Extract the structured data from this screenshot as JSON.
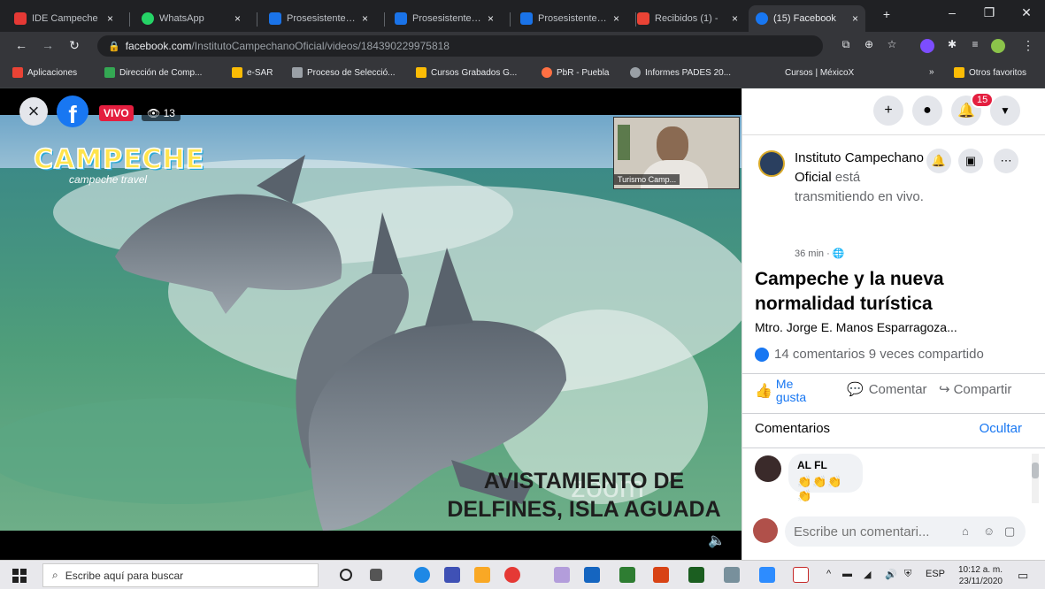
{
  "browser": {
    "tabs": [
      {
        "label": "IDE Campeche",
        "color": "#e53935"
      },
      {
        "label": "WhatsApp",
        "color": "#25d366"
      },
      {
        "label": "Prosesistente - 2",
        "color": "#1a73e8"
      },
      {
        "label": "Prosesistente - 2",
        "color": "#1a73e8"
      },
      {
        "label": "Prosesistente - 2",
        "color": "#1a73e8"
      },
      {
        "label": "Recibidos (1) -",
        "color": "#ea4335"
      },
      {
        "label": "(15) Facebook",
        "color": "#1877f2"
      }
    ],
    "new_tab": "+",
    "url_host": "facebook.com",
    "url_path": "/InstitutoCampechanoOficial/videos/184390229975818",
    "bookmarks": [
      {
        "label": "Aplicaciones",
        "color": "#ea4335"
      },
      {
        "label": "Dirección de Comp...",
        "color": "#34a853"
      },
      {
        "label": "e-SAR",
        "color": "#fbbc05"
      },
      {
        "label": "Proceso de Selecció...",
        "color": "#9aa0a6"
      },
      {
        "label": "Cursos Grabados G...",
        "color": "#fbbc05"
      },
      {
        "label": "PbR - Puebla",
        "color": "#ff7043"
      },
      {
        "label": "Informes PADES 20...",
        "color": "#9aa0a6"
      },
      {
        "label": "Cursos | MéxicoX",
        "color": "#35363a"
      }
    ],
    "bookmarks_more": "»",
    "other_bookmarks": "Otros favoritos"
  },
  "video": {
    "live_label": "VIVO",
    "viewers": "13",
    "brand_title": "CAMPECHE",
    "brand_subtitle": "campeche travel",
    "pip_name": "Turismo Camp...",
    "caption_line1": "AVISTAMIENTO DE",
    "caption_line2": "DELFINES, ISLA AGUADA",
    "watermark": "zoom"
  },
  "panel": {
    "notifications_count": "15",
    "page_name": "Instituto Campechano Oficial",
    "status": "está transmitiendo en vivo.",
    "time_ago": "36 min · ",
    "title": "Campeche y la nueva normalidad turística",
    "presenter": "Mtro. Jorge E. Manos Esparragoza...",
    "stats": "14 comentarios 9 veces compartido",
    "like_label": "Me gusta",
    "comment_label": "Comentar",
    "share_label": "Compartir",
    "comments_heading": "Comentarios",
    "hide_label": "Ocultar",
    "comment": {
      "author": "AL FL",
      "text": "👏👏👏👏"
    },
    "comment_placeholder": "Escribe un comentari..."
  },
  "taskbar": {
    "search_placeholder": "Escribe aquí para buscar",
    "language": "ESP",
    "time": "10:12 a. m.",
    "date": "23/11/2020"
  }
}
